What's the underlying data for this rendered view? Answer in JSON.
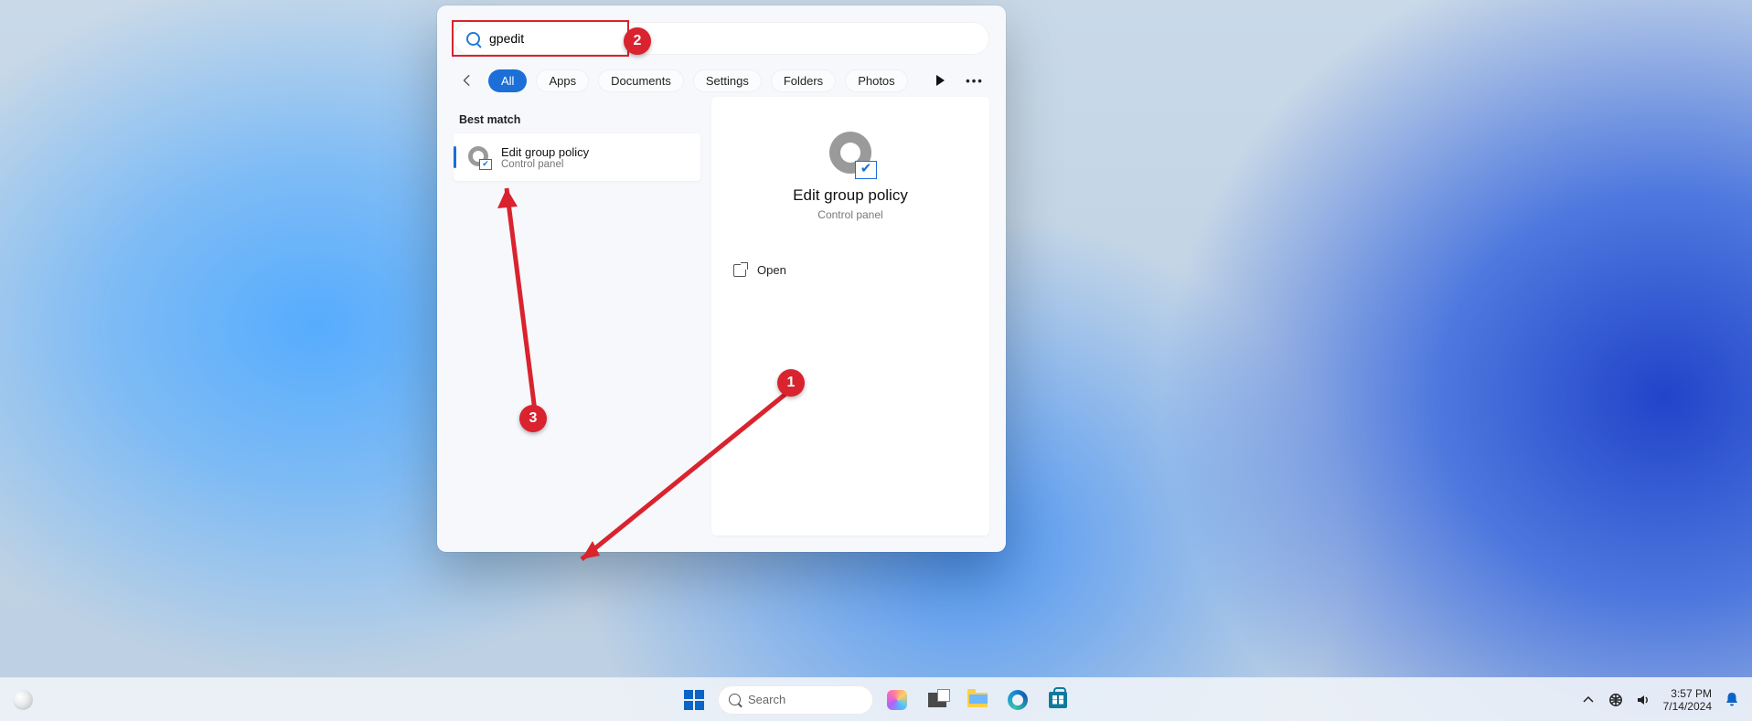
{
  "search": {
    "query": "gpedit",
    "filters": [
      "All",
      "Apps",
      "Documents",
      "Settings",
      "Folders",
      "Photos"
    ],
    "active_filter": "All",
    "best_match_label": "Best match",
    "result": {
      "title": "Edit group policy",
      "subtitle": "Control panel"
    },
    "preview": {
      "title": "Edit group policy",
      "subtitle": "Control panel",
      "open_label": "Open"
    }
  },
  "annotations": {
    "1": "1",
    "2": "2",
    "3": "3"
  },
  "taskbar": {
    "search_placeholder": "Search",
    "time": "3:57 PM",
    "date": "7/14/2024"
  }
}
